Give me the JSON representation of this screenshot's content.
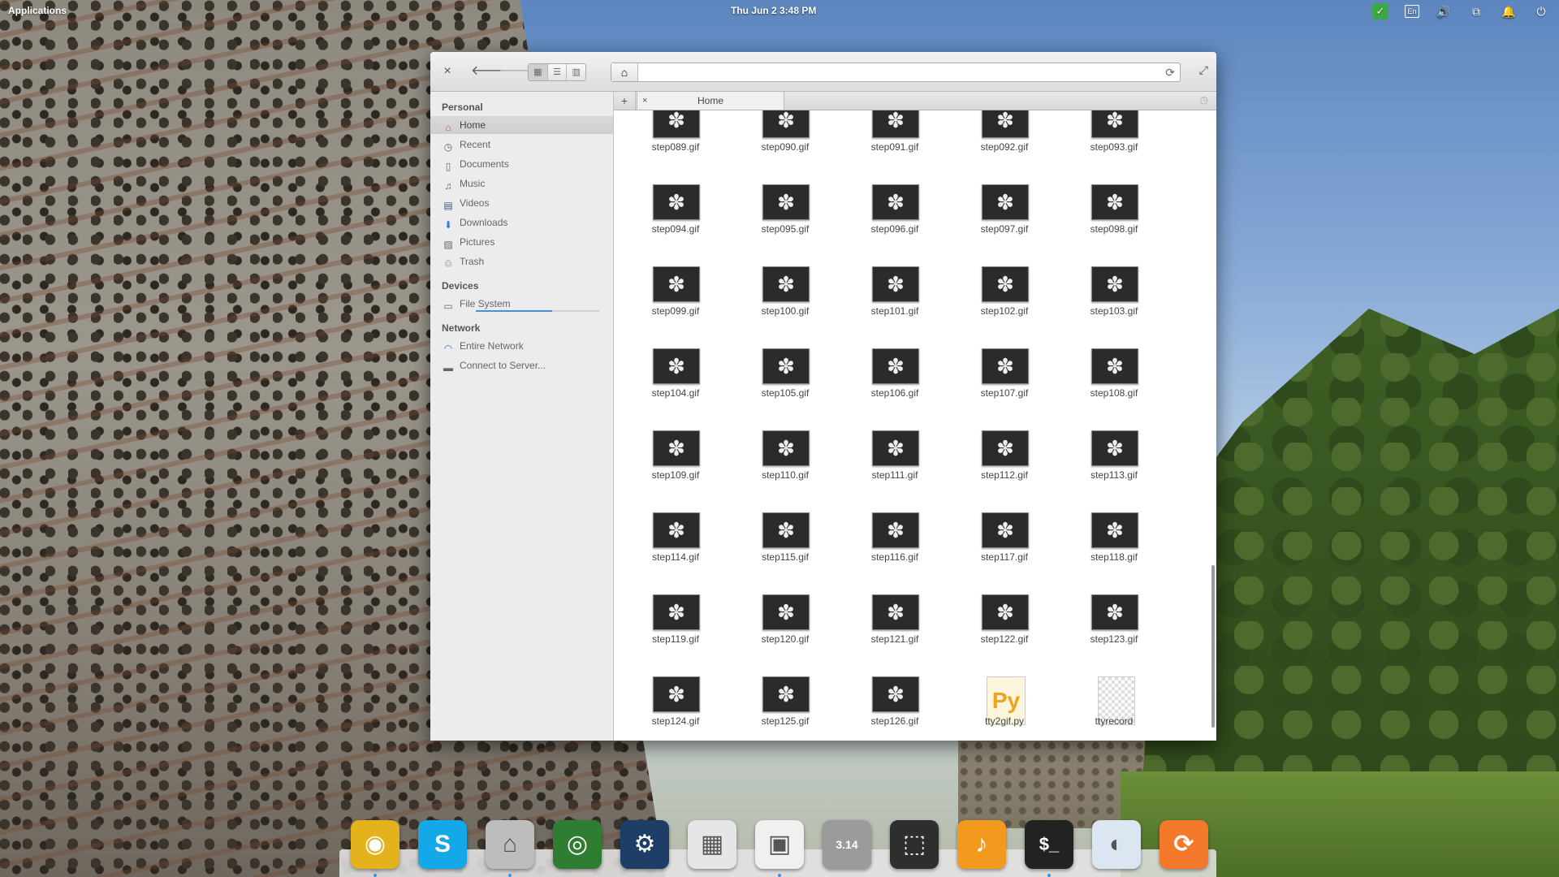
{
  "top_panel": {
    "applications_label": "Applications",
    "clock": "Thu Jun  2   3:48 PM",
    "tray": {
      "check": "✓",
      "lang": "En",
      "volume": "🔊",
      "network": "⧉",
      "notifications": "🔔",
      "power": "⏻"
    }
  },
  "window": {
    "toolbar": {
      "close": "×",
      "back": "🡐",
      "forward": "🡒",
      "views": [
        "▦",
        "☰",
        "▥"
      ],
      "home": "⌂",
      "reload": "⟳",
      "maximize": "⤢"
    },
    "sidebar": {
      "personal_heading": "Personal",
      "personal_items": [
        {
          "label": "Home",
          "icon": "⌂"
        },
        {
          "label": "Recent",
          "icon": "◷"
        },
        {
          "label": "Documents",
          "icon": "▯"
        },
        {
          "label": "Music",
          "icon": "♫"
        },
        {
          "label": "Videos",
          "icon": "▤"
        },
        {
          "label": "Downloads",
          "icon": "⬇"
        },
        {
          "label": "Pictures",
          "icon": "▨"
        },
        {
          "label": "Trash",
          "icon": "♲"
        }
      ],
      "devices_heading": "Devices",
      "devices_items": [
        {
          "label": "File System",
          "icon": "▭",
          "usage": 0.62
        }
      ],
      "network_heading": "Network",
      "network_items": [
        {
          "label": "Entire Network",
          "icon": "◠"
        },
        {
          "label": "Connect to Server...",
          "icon": "▬"
        }
      ]
    },
    "tabs": {
      "add": "+",
      "close": "×",
      "home_tab_label": "Home",
      "history": "◷"
    },
    "files": [
      "step089.gif",
      "step090.gif",
      "step091.gif",
      "step092.gif",
      "step093.gif",
      "step094.gif",
      "step095.gif",
      "step096.gif",
      "step097.gif",
      "step098.gif",
      "step099.gif",
      "step100.gif",
      "step101.gif",
      "step102.gif",
      "step103.gif",
      "step104.gif",
      "step105.gif",
      "step106.gif",
      "step107.gif",
      "step108.gif",
      "step109.gif",
      "step110.gif",
      "step111.gif",
      "step112.gif",
      "step113.gif",
      "step114.gif",
      "step115.gif",
      "step116.gif",
      "step117.gif",
      "step118.gif",
      "step119.gif",
      "step120.gif",
      "step121.gif",
      "step122.gif",
      "step123.gif",
      "step124.gif",
      "step125.gif",
      "step126.gif",
      "tty2gif.py",
      "ttyrecord"
    ],
    "gif_glyph": "✽",
    "py_glyph": "Py"
  },
  "dock": {
    "items": [
      {
        "name": "chrome",
        "glyph": "◉",
        "color": "#e3b21c"
      },
      {
        "name": "skype",
        "glyph": "S",
        "color": "#15a8e8"
      },
      {
        "name": "files",
        "glyph": "⌂",
        "color": "#bdbdbd"
      },
      {
        "name": "nvidia",
        "glyph": "◎",
        "color": "#2e7d32"
      },
      {
        "name": "steam",
        "glyph": "⚙",
        "color": "#1d3e66"
      },
      {
        "name": "spreadsheet",
        "glyph": "▦",
        "color": "#e6e6e6"
      },
      {
        "name": "document-viewer",
        "glyph": "▣",
        "color": "#f0f0f0"
      },
      {
        "name": "calculator",
        "glyph": "3.14",
        "color": "#9b9b9b"
      },
      {
        "name": "screenshot",
        "glyph": "⬚",
        "color": "#2e2e2e"
      },
      {
        "name": "music",
        "glyph": "♪",
        "color": "#f39a1e"
      },
      {
        "name": "terminal",
        "glyph": "$_",
        "color": "#222222"
      },
      {
        "name": "switchboard",
        "glyph": "◐",
        "color": "#dce6f2"
      },
      {
        "name": "update-manager",
        "glyph": "⟳",
        "color": "#f4792a"
      }
    ]
  }
}
